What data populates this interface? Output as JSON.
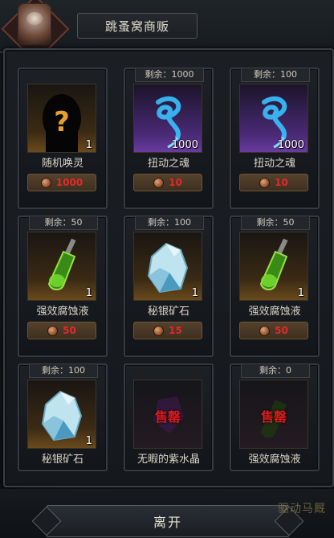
{
  "header": {
    "title": "跳蚤窝商贩"
  },
  "items": [
    {
      "stock": "",
      "name": "随机唤灵",
      "qty": "1",
      "price": "1000",
      "icon": "mystery-silhouette-icon",
      "sold_out": ""
    },
    {
      "stock": "剩余：1000",
      "name": "扭动之魂",
      "qty": "1000",
      "price": "10",
      "icon": "blue-soul-wisp-icon",
      "sold_out": ""
    },
    {
      "stock": "剩余：100",
      "name": "扭动之魂",
      "qty": "1000",
      "price": "10",
      "icon": "blue-soul-wisp-icon",
      "sold_out": ""
    },
    {
      "stock": "剩余：50",
      "name": "强效腐蚀液",
      "qty": "1",
      "price": "50",
      "icon": "green-potion-vial-icon",
      "sold_out": ""
    },
    {
      "stock": "剩余：100",
      "name": "秘银矿石",
      "qty": "1",
      "price": "15",
      "icon": "mithril-ore-icon",
      "sold_out": ""
    },
    {
      "stock": "剩余：50",
      "name": "强效腐蚀液",
      "qty": "1",
      "price": "50",
      "icon": "green-potion-vial-icon",
      "sold_out": ""
    },
    {
      "stock": "剩余：100",
      "name": "秘银矿石",
      "qty": "1",
      "price": "",
      "icon": "mithril-ore-icon",
      "sold_out": ""
    },
    {
      "stock": "",
      "name": "无暇的紫水晶",
      "qty": "",
      "price": "",
      "icon": "purple-crystal-icon",
      "sold_out": "售罄"
    },
    {
      "stock": "剩余：0",
      "name": "强效腐蚀液",
      "qty": "",
      "price": "",
      "icon": "green-potion-vial-icon",
      "sold_out": "售罄"
    }
  ],
  "footer": {
    "leave_label": "离开",
    "watermark": "驱动马厩"
  },
  "colors": {
    "price_text": "#e02a2a",
    "sold_out": "#d81c1c"
  }
}
